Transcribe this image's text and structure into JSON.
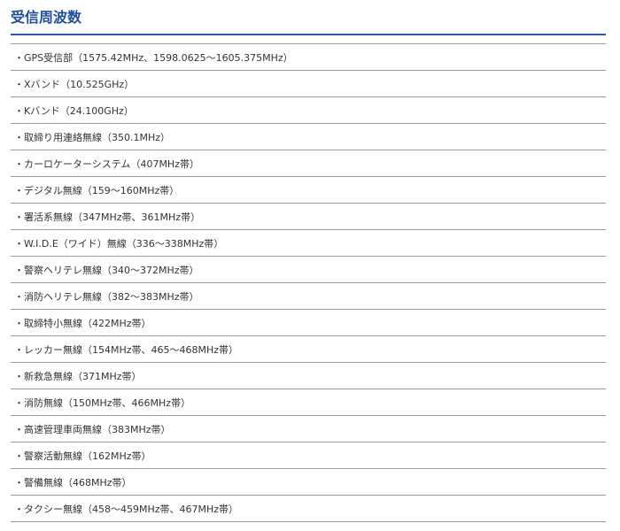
{
  "section": {
    "title": "受信周波数"
  },
  "bullet": "・",
  "items": [
    "GPS受信部（1575.42MHz、1598.0625〜1605.375MHz）",
    "Xバンド（10.525GHz）",
    "Kバンド（24.100GHz）",
    "取締り用連絡無線（350.1MHz）",
    "カーロケーターシステム（407MHz帯）",
    "デジタル無線（159〜160MHz帯）",
    "署活系無線（347MHz帯、361MHz帯）",
    "W.I.D.E（ワイド）無線（336〜338MHz帯）",
    "警察ヘリテレ無線（340〜372MHz帯）",
    "消防ヘリテレ無線（382〜383MHz帯）",
    "取締特小無線（422MHz帯）",
    "レッカー無線（154MHz帯、465〜468MHz帯）",
    "新救急無線（371MHz帯）",
    "消防無線（150MHz帯、466MHz帯）",
    "高速管理車両無線（383MHz帯）",
    "警察活動無線（162MHz帯）",
    "警備無線（468MHz帯）",
    "タクシー無線（458〜459MHz帯、467MHz帯）"
  ],
  "colors": {
    "title": "#1f4e9c",
    "rule": "#2b57a6",
    "divider": "#9a9a9a",
    "text": "#333333"
  }
}
